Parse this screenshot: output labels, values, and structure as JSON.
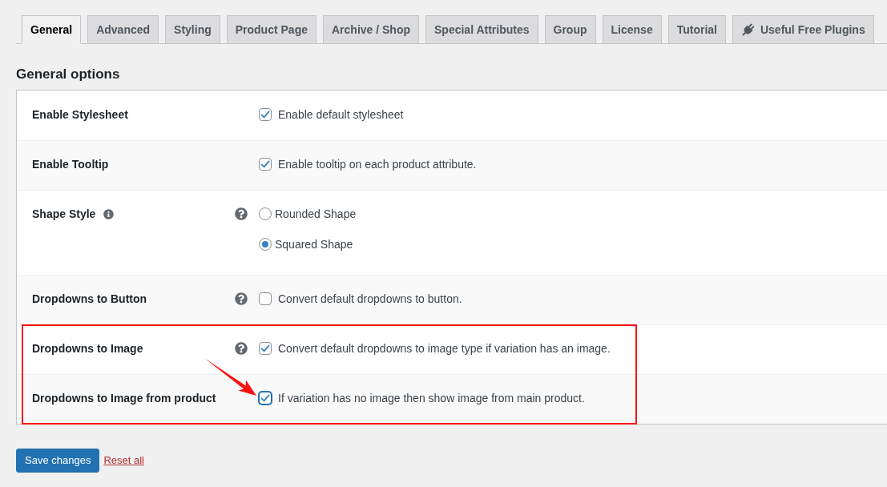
{
  "tabs": [
    {
      "label": "General",
      "selected": true,
      "kind": "settings"
    },
    {
      "label": "Advanced",
      "selected": false,
      "kind": "settings"
    },
    {
      "label": "Styling",
      "selected": false,
      "kind": "settings"
    },
    {
      "label": "Product Page",
      "selected": false,
      "kind": "settings"
    },
    {
      "label": "Archive / Shop",
      "selected": false,
      "kind": "settings"
    },
    {
      "label": "Special Attributes",
      "selected": false,
      "kind": "settings"
    },
    {
      "label": "Group",
      "selected": false,
      "kind": "settings"
    },
    {
      "label": "License",
      "selected": false,
      "kind": "settings"
    },
    {
      "label": "Tutorial",
      "selected": false,
      "kind": "settings"
    },
    {
      "label": "Useful Free Plugins",
      "selected": false,
      "kind": "plugins"
    }
  ],
  "heading": "General options",
  "rows": [
    {
      "label": "Enable Stylesheet",
      "info": false,
      "help": false,
      "highlighted": false,
      "pointed": false,
      "control": {
        "kind": "checkbox",
        "checked": true,
        "focused": false,
        "text": "Enable default stylesheet"
      }
    },
    {
      "label": "Enable Tooltip",
      "info": false,
      "help": false,
      "highlighted": false,
      "pointed": false,
      "control": {
        "kind": "checkbox",
        "checked": true,
        "focused": false,
        "text": "Enable tooltip on each product attribute."
      }
    },
    {
      "label": "Shape Style",
      "info": true,
      "help": true,
      "highlighted": false,
      "pointed": false,
      "control": {
        "kind": "radio",
        "options": [
          {
            "label": "Rounded Shape",
            "selected": false
          },
          {
            "label": "Squared Shape",
            "selected": true
          }
        ]
      }
    },
    {
      "label": "Dropdowns to Button",
      "info": false,
      "help": true,
      "highlighted": false,
      "pointed": false,
      "control": {
        "kind": "checkbox",
        "checked": false,
        "focused": false,
        "text": "Convert default dropdowns to button."
      }
    },
    {
      "label": "Dropdowns to Image",
      "info": false,
      "help": true,
      "highlighted": true,
      "pointed": false,
      "control": {
        "kind": "checkbox",
        "checked": true,
        "focused": false,
        "text": "Convert default dropdowns to image type if variation has an image."
      }
    },
    {
      "label": "Dropdowns to Image from product",
      "info": false,
      "help": false,
      "highlighted": true,
      "pointed": true,
      "control": {
        "kind": "checkbox",
        "checked": true,
        "focused": true,
        "text": "If variation has no image then show image from main product."
      }
    }
  ],
  "actions": {
    "save": "Save changes",
    "reset": "Reset all"
  }
}
